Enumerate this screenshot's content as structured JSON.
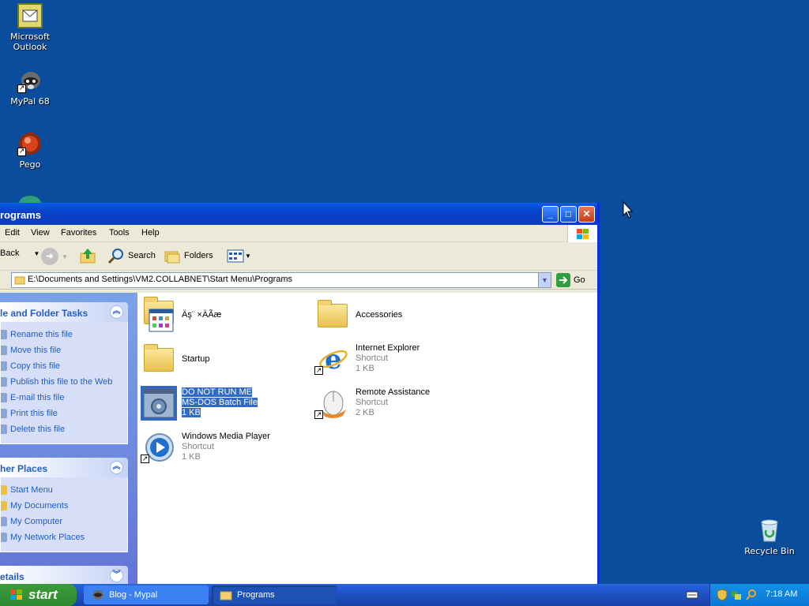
{
  "desktop": {
    "icons": [
      {
        "label": "Microsoft\nOutlook"
      },
      {
        "label": "MyPal 68"
      },
      {
        "label": "Pego"
      },
      {
        "label": "Recycle Bin"
      }
    ]
  },
  "window": {
    "title": "rograms",
    "menu": [
      "Edit",
      "View",
      "Favorites",
      "Tools",
      "Help"
    ],
    "toolbar": {
      "back": "Back",
      "search": "Search",
      "folders": "Folders"
    },
    "address": {
      "value": "E:\\Documents and Settings\\VM2.COLLABNET\\Start Menu\\Programs",
      "go": "Go"
    }
  },
  "taskpane": {
    "file_tasks": {
      "title": "le and Folder Tasks",
      "items": [
        "Rename this file",
        "Move this file",
        "Copy this file",
        "Publish this file to the Web",
        "E-mail this file",
        "Print this file",
        "Delete this file"
      ]
    },
    "other_places": {
      "title": "her Places",
      "items": [
        "Start Menu",
        "My Documents",
        "My Computer",
        "My Network Places"
      ]
    },
    "details": {
      "title": "etails"
    }
  },
  "files": [
    {
      "name": "Äş¨ ×ÄÃæ",
      "type": "",
      "size": ""
    },
    {
      "name": "Accessories",
      "type": "",
      "size": ""
    },
    {
      "name": "Startup",
      "type": "",
      "size": ""
    },
    {
      "name": "Internet Explorer",
      "type": "Shortcut",
      "size": "1 KB"
    },
    {
      "name": "DO NOT RUN ME",
      "type": "MS-DOS Batch File",
      "size": "1 KB"
    },
    {
      "name": "Remote Assistance",
      "type": "Shortcut",
      "size": "2 KB"
    },
    {
      "name": "Windows Media Player",
      "type": "Shortcut",
      "size": "1 KB"
    }
  ],
  "taskbar": {
    "start": "start",
    "buttons": [
      "Blog - Mypal",
      "Programs"
    ],
    "clock": "7:18 AM"
  },
  "colors": {
    "desktop": "#0a4d9c",
    "title": "#0a5fe8",
    "link": "#215dc6",
    "selection": "#316ac5"
  }
}
